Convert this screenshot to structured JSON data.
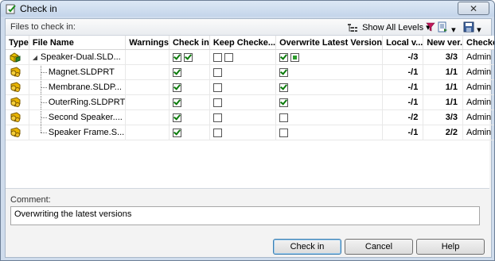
{
  "window": {
    "title": "Check in",
    "close_glyph": "✕"
  },
  "toolbar": {
    "files_label": "Files to check in:",
    "levels_label": "Show All Levels",
    "dropdown_glyph": "▾"
  },
  "table": {
    "headers": [
      "Type",
      "File Name",
      "Warnings",
      "Check in",
      "Keep Checke...",
      "Overwrite Latest Version",
      "Local v...",
      "New ver.",
      "Checked Out By"
    ],
    "rows": [
      {
        "level": 0,
        "expander": "◢",
        "name": "Speaker-Dual.SLD...",
        "warnings": "",
        "checkin": [
          "on",
          "on"
        ],
        "keep": [
          "off",
          "off"
        ],
        "overwrite": [
          "on",
          "mixed"
        ],
        "local": "-/3",
        "newver": "3/3",
        "by": "Admin",
        "icon": "assembly-icon"
      },
      {
        "level": 1,
        "expander": "",
        "name": "Magnet.SLDPRT",
        "warnings": "",
        "checkin": [
          "on"
        ],
        "keep": [
          "off"
        ],
        "overwrite": [
          "on"
        ],
        "local": "-/1",
        "newver": "1/1",
        "by": "Admin",
        "icon": "part-icon"
      },
      {
        "level": 1,
        "expander": "",
        "name": "Membrane.SLDP...",
        "warnings": "",
        "checkin": [
          "on"
        ],
        "keep": [
          "off"
        ],
        "overwrite": [
          "on"
        ],
        "local": "-/1",
        "newver": "1/1",
        "by": "Admin",
        "icon": "part-icon"
      },
      {
        "level": 1,
        "expander": "",
        "name": "OuterRing.SLDPRT",
        "warnings": "",
        "checkin": [
          "on"
        ],
        "keep": [
          "off"
        ],
        "overwrite": [
          "on"
        ],
        "local": "-/1",
        "newver": "1/1",
        "by": "Admin",
        "icon": "part-icon"
      },
      {
        "level": 1,
        "expander": "",
        "name": "Second Speaker....",
        "warnings": "",
        "checkin": [
          "on"
        ],
        "keep": [
          "off"
        ],
        "overwrite": [
          "off"
        ],
        "local": "-/2",
        "newver": "3/3",
        "by": "Admin",
        "icon": "part-icon"
      },
      {
        "level": 1,
        "expander": "",
        "name": "Speaker Frame.S...",
        "warnings": "",
        "checkin": [
          "on"
        ],
        "keep": [
          "off"
        ],
        "overwrite": [
          "off"
        ],
        "local": "-/1",
        "newver": "2/2",
        "by": "Admin",
        "icon": "part-icon"
      }
    ]
  },
  "comment": {
    "label": "Comment:",
    "value": "Overwriting the latest versions"
  },
  "buttons": {
    "checkin": "Check in",
    "cancel": "Cancel",
    "help": "Help"
  },
  "colors": {
    "check_green": "#0a7a0a",
    "filter_magenta": "#c2185b",
    "part_yellow": "#e8b400"
  }
}
